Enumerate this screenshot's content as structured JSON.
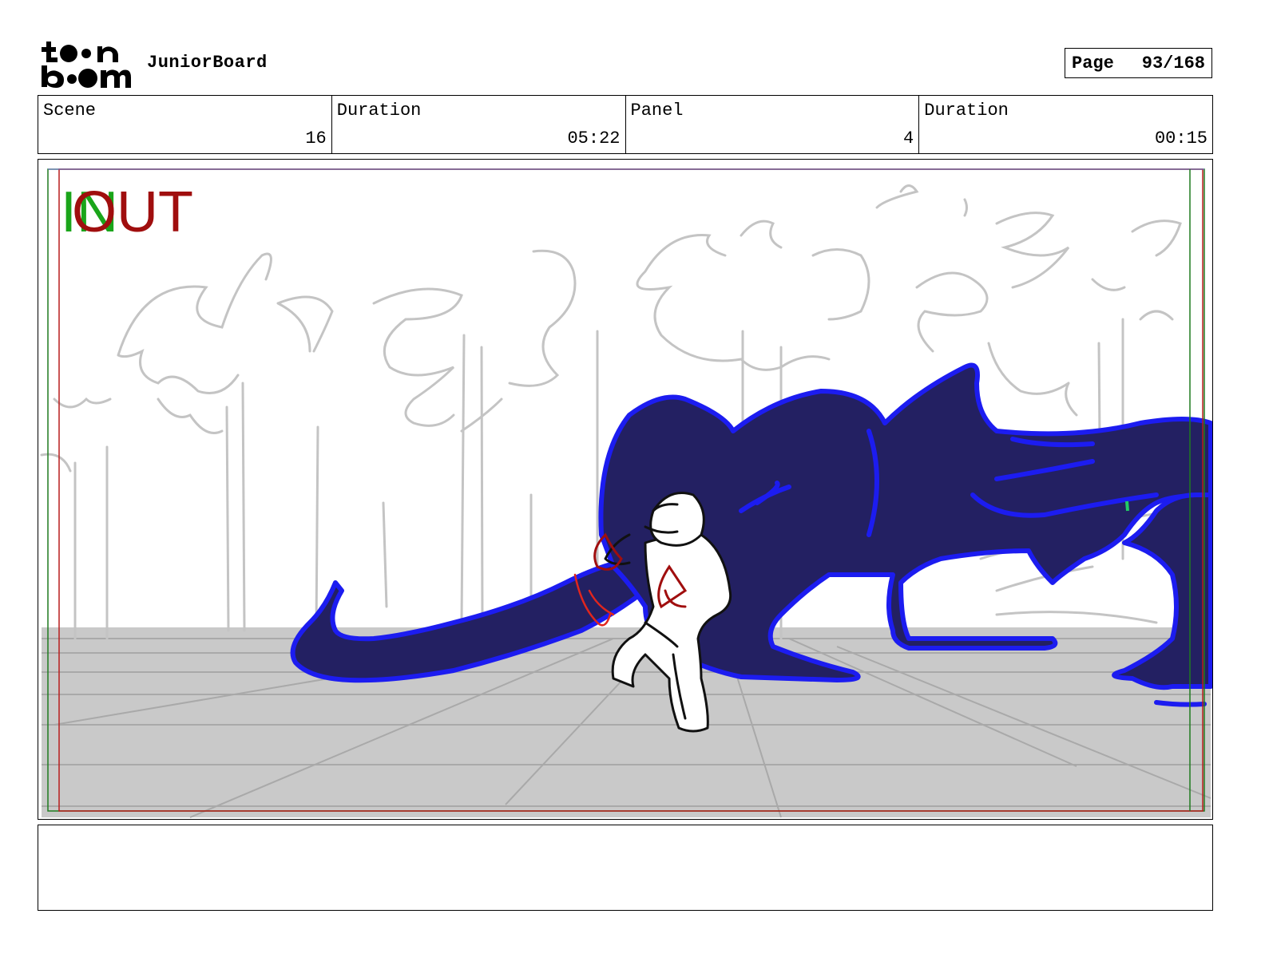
{
  "header": {
    "logo_text_top": "toon",
    "logo_text_bottom": "boom",
    "app_title": "JuniorBoard",
    "page_label": "Page",
    "page_value": "93/168"
  },
  "info": [
    {
      "label": "Scene",
      "value": "16"
    },
    {
      "label": "Duration",
      "value": "05:22"
    },
    {
      "label": "Panel",
      "value": "4"
    },
    {
      "label": "Duration",
      "value": "00:15"
    }
  ],
  "panel": {
    "in_marker": "IN",
    "out_marker": "OUT",
    "colors": {
      "in_marker": "#1aa51a",
      "out_marker": "#a00e0e",
      "creature_fill": "#232062",
      "creature_outline": "#1c1cf0",
      "floor": "#c9c9c9",
      "background_sketch": "#c0c0c0"
    }
  },
  "caption": {
    "text": ""
  }
}
